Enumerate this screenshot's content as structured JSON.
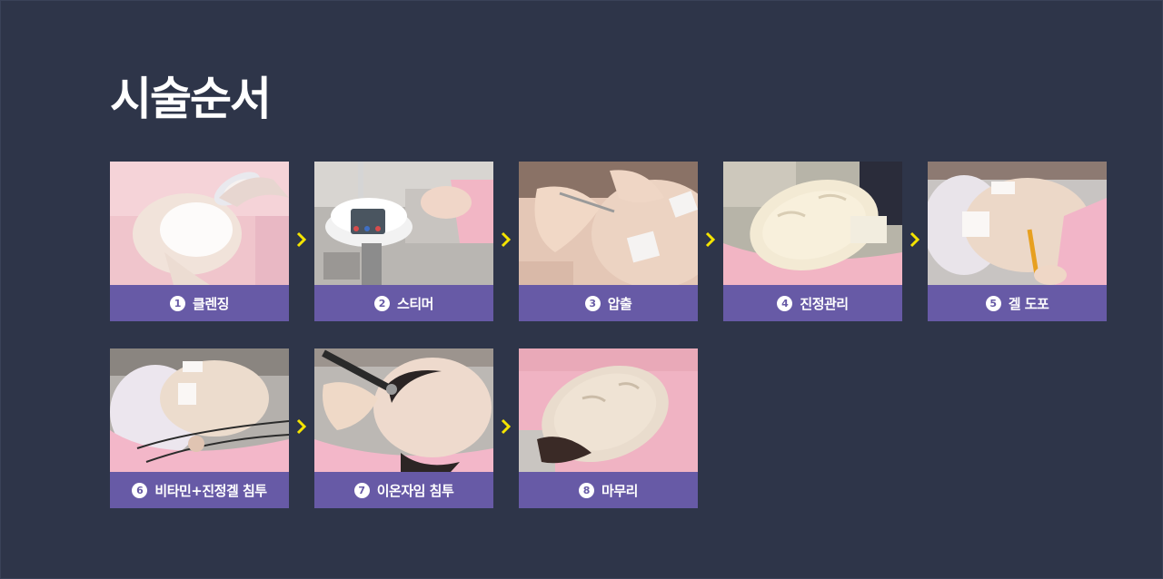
{
  "title": "시술순서",
  "steps": [
    {
      "num": "1",
      "label": "클렌징"
    },
    {
      "num": "2",
      "label": "스티머"
    },
    {
      "num": "3",
      "label": "압출"
    },
    {
      "num": "4",
      "label": "진정관리"
    },
    {
      "num": "5",
      "label": "겔 도포"
    },
    {
      "num": "6",
      "label": "비타민+진정겔 침투"
    },
    {
      "num": "7",
      "label": "이온자임 침투"
    },
    {
      "num": "8",
      "label": "마무리"
    }
  ],
  "colors": {
    "background": "#2e3549",
    "caption_bg": "#675aa6",
    "arrow": "#f5e400",
    "title": "#ffffff"
  }
}
